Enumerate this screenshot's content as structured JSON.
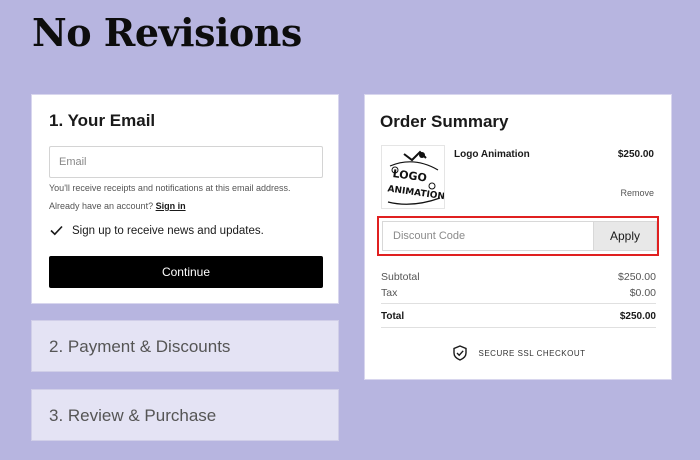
{
  "brand": {
    "name": "No Revisions"
  },
  "email_step": {
    "title": "1.  Your Email",
    "email_placeholder": "Email",
    "receipts_note": "You'll receive receipts and notifications at this email address.",
    "account_prompt": "Already have an account?",
    "sign_in_label": "Sign in",
    "newsletter_label": "Sign up to receive news and updates.",
    "newsletter_checked": true,
    "continue_label": "Continue"
  },
  "steps": [
    {
      "label": "2.  Payment & Discounts"
    },
    {
      "label": "3.  Review & Purchase"
    }
  ],
  "order_summary": {
    "title": "Order Summary",
    "item": {
      "name": "Logo Animation",
      "price": "$250.00",
      "remove_label": "Remove",
      "thumb_text": "LOGO ANIMATION"
    },
    "discount": {
      "placeholder": "Discount Code",
      "apply_label": "Apply",
      "highlight_color": "#e02020"
    },
    "subtotal_label": "Subtotal",
    "subtotal_value": "$250.00",
    "tax_label": "Tax",
    "tax_value": "$0.00",
    "total_label": "Total",
    "total_value": "$250.00",
    "ssl_label": "SECURE SSL CHECKOUT"
  },
  "colors": {
    "background": "#b7b5e0",
    "button": "#000000",
    "collapsed_step": "#e4e3f4"
  }
}
